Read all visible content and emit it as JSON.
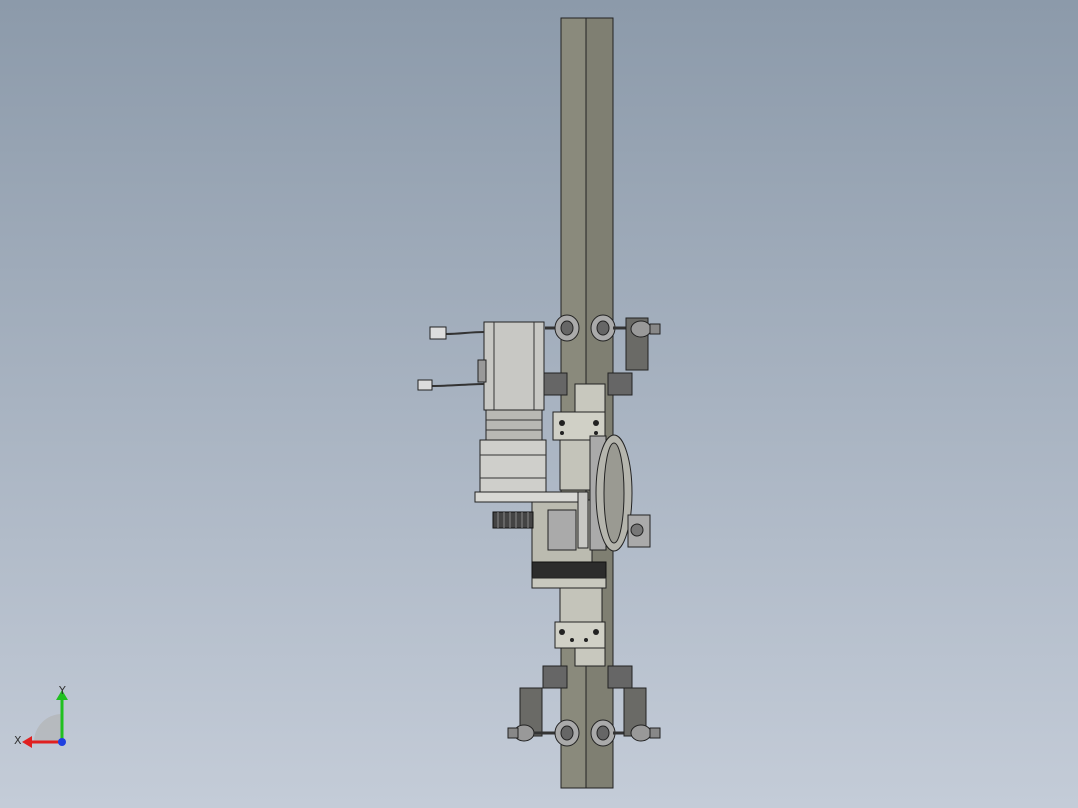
{
  "viewport": {
    "background_top": "#8c9aaa",
    "background_bottom": "#c4ccd8"
  },
  "model": {
    "components": [
      "vertical-rail",
      "servo-motor",
      "motor-cable-top",
      "motor-cable-bottom",
      "gear-reducer",
      "pinion-gear",
      "carriage-plate",
      "timing-pulley",
      "upper-mount-left",
      "upper-mount-right",
      "lower-mount-left",
      "lower-mount-right"
    ]
  },
  "triad": {
    "x_label": "X",
    "y_label": "Y",
    "x_color": "#e02020",
    "y_color": "#20c020",
    "z_color": "#2040e0"
  }
}
